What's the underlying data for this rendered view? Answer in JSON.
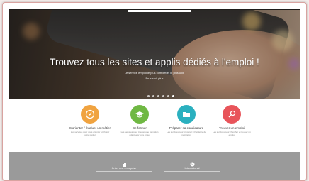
{
  "hero": {
    "title": "Trouvez tous les sites et applis dédiés à l'emploi !",
    "subtitle": "Le service emploi le plus complet et le plus utile",
    "subtitle2": "En savoir plus",
    "slide_count": 6,
    "active_slide": 6
  },
  "cards": [
    {
      "title": "S'orienter / Évaluer un métier",
      "desc": "Les services pour vous orienter et choisir votre métier",
      "color": "#f0a340",
      "icon": "compass-icon"
    },
    {
      "title": "Se former",
      "desc": "Les services pour trouver une formation adaptée à votre projet",
      "color": "#6fb843",
      "icon": "graduation-cap-icon"
    },
    {
      "title": "Préparer sa candidature",
      "desc": "Les services pour préparer CV et lettre de motivation",
      "color": "#2bb0bf",
      "icon": "folder-icon"
    },
    {
      "title": "Trouver un emploi",
      "desc": "Les services pour chercher et trouver un emploi",
      "color": "#e8545a",
      "icon": "search-icon"
    }
  ],
  "bottom": [
    {
      "label": "Créer une entreprise",
      "icon": "building-icon"
    },
    {
      "label": "International",
      "icon": "globe-icon"
    }
  ],
  "colors": {
    "bottom_band": "#9a9a9a",
    "frame_border": "#d9a3a0"
  }
}
